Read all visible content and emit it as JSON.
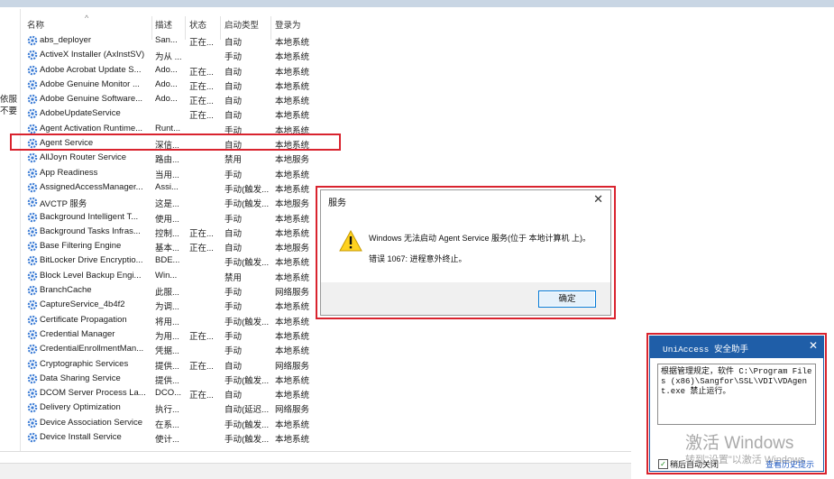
{
  "services_list": {
    "headers": {
      "name": "名称",
      "description": "描述",
      "status": "状态",
      "startup_type": "启动类型",
      "logon_as": "登录为"
    },
    "left_fragment": [
      "依服",
      "不要"
    ],
    "rows": [
      {
        "name": "abs_deployer",
        "description": "San...",
        "status": "正在...",
        "startup": "自动",
        "logon": "本地系统"
      },
      {
        "name": "ActiveX Installer (AxInstSV)",
        "description": "为从 ...",
        "status": "",
        "startup": "手动",
        "logon": "本地系统"
      },
      {
        "name": "Adobe Acrobat Update S...",
        "description": "Ado...",
        "status": "正在...",
        "startup": "自动",
        "logon": "本地系统"
      },
      {
        "name": "Adobe Genuine Monitor ...",
        "description": "Ado...",
        "status": "正在...",
        "startup": "自动",
        "logon": "本地系统"
      },
      {
        "name": "Adobe Genuine Software...",
        "description": "Ado...",
        "status": "正在...",
        "startup": "自动",
        "logon": "本地系统"
      },
      {
        "name": "AdobeUpdateService",
        "description": "",
        "status": "正在...",
        "startup": "自动",
        "logon": "本地系统"
      },
      {
        "name": "Agent Activation Runtime...",
        "description": "Runt...",
        "status": "",
        "startup": "手动",
        "logon": "本地系统"
      },
      {
        "name": "Agent Service",
        "description": "深信...",
        "status": "",
        "startup": "自动",
        "logon": "本地系统"
      },
      {
        "name": "AllJoyn Router Service",
        "description": "路由...",
        "status": "",
        "startup": "禁用",
        "logon": "本地服务"
      },
      {
        "name": "App Readiness",
        "description": "当用...",
        "status": "",
        "startup": "手动",
        "logon": "本地系统"
      },
      {
        "name": "AssignedAccessManager...",
        "description": "Assi...",
        "status": "",
        "startup": "手动(触发...",
        "logon": "本地系统"
      },
      {
        "name": "AVCTP 服务",
        "description": "这是...",
        "status": "",
        "startup": "手动(触发...",
        "logon": "本地服务"
      },
      {
        "name": "Background Intelligent T...",
        "description": "使用...",
        "status": "",
        "startup": "手动",
        "logon": "本地系统"
      },
      {
        "name": "Background Tasks Infras...",
        "description": "控制...",
        "status": "正在...",
        "startup": "自动",
        "logon": "本地系统"
      },
      {
        "name": "Base Filtering Engine",
        "description": "基本...",
        "status": "正在...",
        "startup": "自动",
        "logon": "本地服务"
      },
      {
        "name": "BitLocker Drive Encryptio...",
        "description": "BDE...",
        "status": "",
        "startup": "手动(触发...",
        "logon": "本地系统"
      },
      {
        "name": "Block Level Backup Engi...",
        "description": "Win...",
        "status": "",
        "startup": "禁用",
        "logon": "本地系统"
      },
      {
        "name": "BranchCache",
        "description": "此服...",
        "status": "",
        "startup": "手动",
        "logon": "网络服务"
      },
      {
        "name": "CaptureService_4b4f2",
        "description": "为调...",
        "status": "",
        "startup": "手动",
        "logon": "本地系统"
      },
      {
        "name": "Certificate Propagation",
        "description": "将用...",
        "status": "",
        "startup": "手动(触发...",
        "logon": "本地系统"
      },
      {
        "name": "Credential Manager",
        "description": "为用...",
        "status": "正在...",
        "startup": "手动",
        "logon": "本地系统"
      },
      {
        "name": "CredentialEnrollmentMan...",
        "description": "凭据...",
        "status": "",
        "startup": "手动",
        "logon": "本地系统"
      },
      {
        "name": "Cryptographic Services",
        "description": "提供...",
        "status": "正在...",
        "startup": "自动",
        "logon": "网络服务"
      },
      {
        "name": "Data Sharing Service",
        "description": "提供...",
        "status": "",
        "startup": "手动(触发...",
        "logon": "本地系统"
      },
      {
        "name": "DCOM Server Process La...",
        "description": "DCO...",
        "status": "正在...",
        "startup": "自动",
        "logon": "本地系统"
      },
      {
        "name": "Delivery Optimization",
        "description": "执行...",
        "status": "",
        "startup": "自动(延迟...",
        "logon": "网络服务"
      },
      {
        "name": "Device Association Service",
        "description": "在系...",
        "status": "",
        "startup": "手动(触发...",
        "logon": "本地系统"
      },
      {
        "name": "Device Install Service",
        "description": "使计...",
        "status": "",
        "startup": "手动(触发...",
        "logon": "本地系统"
      }
    ]
  },
  "error_dialog": {
    "title": "服务",
    "message": "Windows 无法启动 Agent Service 服务(位于 本地计算机 上)。",
    "error_line": "错误 1067: 进程意外终止。",
    "ok_label": "确定"
  },
  "uniaccess_popup": {
    "title": "UniAccess 安全助手",
    "body": "根据管理规定，软件 C:\\Program Files (x86)\\Sangfor\\SSL\\VDI\\VDAgent.exe 禁止运行。",
    "check_label": "稍后自动关闭",
    "history_link": "查看历史提示"
  },
  "watermark": {
    "line1": "激活 Windows",
    "line2": "转到\"设置\"以激活 Windows"
  },
  "colors": {
    "highlight_red": "#d9232e",
    "dialog_title_blue": "#1f5ea8",
    "gear_icon_blue": "#3a7bd5",
    "warning_yellow": "#ffd21f"
  }
}
